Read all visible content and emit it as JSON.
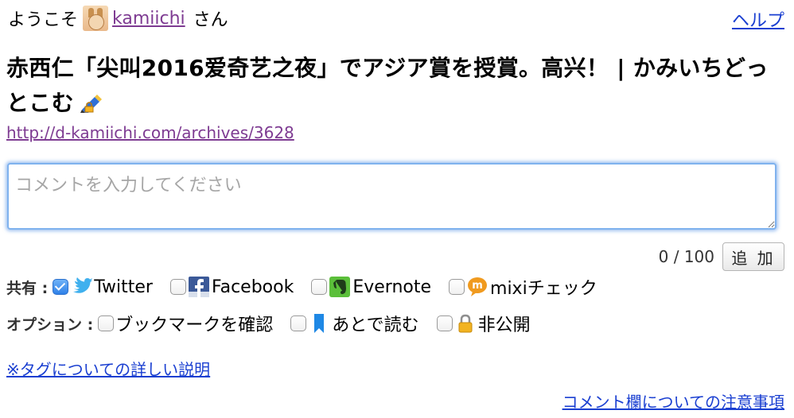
{
  "header": {
    "welcome_prefix": "ようこそ",
    "username": "kamiichi",
    "welcome_suffix": "さん",
    "help_label": "ヘルプ"
  },
  "entry": {
    "title": "赤西仁「尖叫2016爱奇艺之夜」でアジア賞を授賞。高兴！ | かみいちどっとこむ",
    "url": "http://d-kamiichi.com/archives/3628"
  },
  "comment": {
    "placeholder": "コメントを入力してください",
    "value": "",
    "char_count": "0 / 100",
    "add_label": "追 加"
  },
  "share": {
    "label": "共有 :",
    "items": [
      {
        "label": "Twitter",
        "checked": true,
        "icon": "twitter-bird-icon"
      },
      {
        "label": "Facebook",
        "checked": false,
        "icon": "facebook-icon"
      },
      {
        "label": "Evernote",
        "checked": false,
        "icon": "evernote-icon"
      },
      {
        "label": "mixiチェック",
        "checked": false,
        "icon": "mixi-icon"
      }
    ]
  },
  "options": {
    "label": "オプション :",
    "items": [
      {
        "label": "ブックマークを確認",
        "checked": false
      },
      {
        "label": "あとで読む",
        "checked": false,
        "icon": "bookmark-ribbon-icon"
      },
      {
        "label": "非公開",
        "checked": false,
        "icon": "lock-icon"
      }
    ]
  },
  "links": {
    "tag_help": "※タグについての詳しい説明",
    "comment_notes": "コメント欄についての注意事項"
  },
  "colors": {
    "link": "#1a3fd1",
    "visited_link": "#7e3b92",
    "focus_ring": "#7fb2ee",
    "checkbox_checked": "#2f81e8"
  }
}
